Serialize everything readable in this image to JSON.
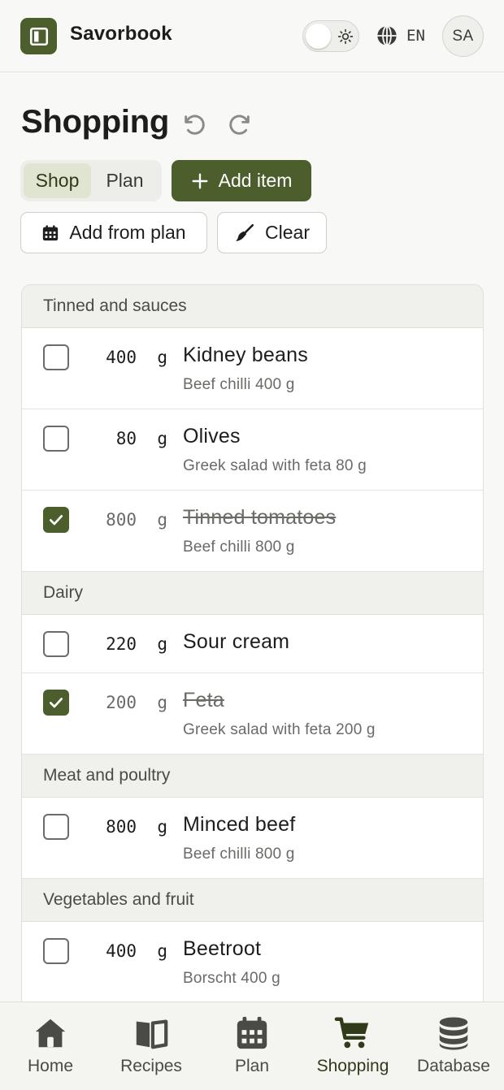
{
  "header": {
    "brand": "Savorbook",
    "language": "EN",
    "avatar_initials": "SA"
  },
  "page": {
    "title": "Shopping",
    "segment": [
      {
        "label": "Shop",
        "active": true
      },
      {
        "label": "Plan",
        "active": false
      }
    ],
    "add_item_label": "Add item",
    "add_from_plan_label": "Add from plan",
    "clear_label": "Clear"
  },
  "groups": [
    {
      "name": "Tinned and sauces",
      "items": [
        {
          "qty": "400",
          "unit": "g",
          "name": "Kidney beans",
          "source": "Beef chilli 400 g",
          "checked": false
        },
        {
          "qty": "80",
          "unit": "g",
          "name": "Olives",
          "source": "Greek salad with feta 80 g",
          "checked": false
        },
        {
          "qty": "800",
          "unit": "g",
          "name": "Tinned tomatoes",
          "source": "Beef chilli 800 g",
          "checked": true
        }
      ]
    },
    {
      "name": "Dairy",
      "items": [
        {
          "qty": "220",
          "unit": "g",
          "name": "Sour cream",
          "source": "",
          "checked": false
        },
        {
          "qty": "200",
          "unit": "g",
          "name": "Feta",
          "source": "Greek salad with feta 200 g",
          "checked": true
        }
      ]
    },
    {
      "name": "Meat and poultry",
      "items": [
        {
          "qty": "800",
          "unit": "g",
          "name": "Minced beef",
          "source": "Beef chilli 800 g",
          "checked": false
        }
      ]
    },
    {
      "name": "Vegetables and fruit",
      "items": [
        {
          "qty": "400",
          "unit": "g",
          "name": "Beetroot",
          "source": "Borscht 400 g",
          "checked": false
        }
      ]
    }
  ],
  "nav": [
    {
      "label": "Home",
      "icon": "home-icon",
      "active": false
    },
    {
      "label": "Recipes",
      "icon": "book-icon",
      "active": false
    },
    {
      "label": "Plan",
      "icon": "calendar-icon",
      "active": false
    },
    {
      "label": "Shopping",
      "icon": "cart-icon",
      "active": true
    },
    {
      "label": "Database",
      "icon": "database-icon",
      "active": false
    }
  ],
  "colors": {
    "brand": "#4b5e2b",
    "segment_active": "#dfe5d0",
    "background": "#f8f8f6"
  }
}
